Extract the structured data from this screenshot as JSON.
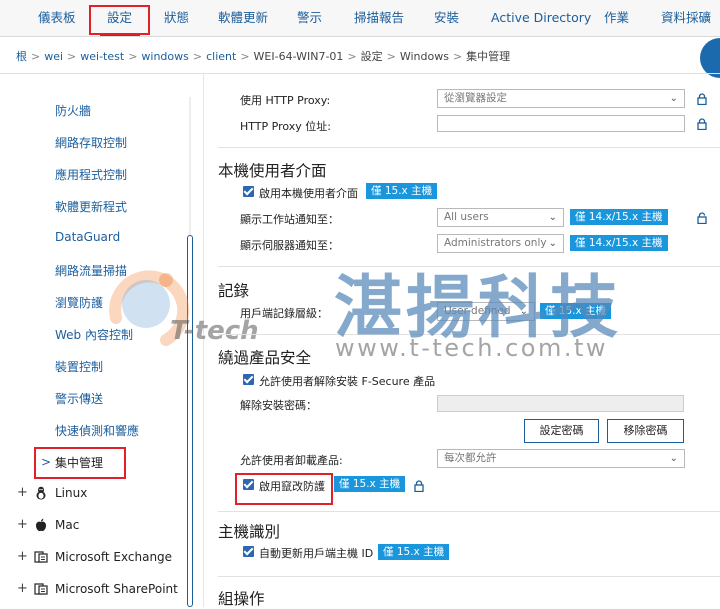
{
  "nav": {
    "tabs": [
      "儀表板",
      "設定",
      "狀態",
      "軟體更新",
      "警示",
      "掃描報告",
      "安裝",
      "Active Directory",
      "作業",
      "資料採礦"
    ],
    "active_index": 1
  },
  "breadcrumb": [
    "根",
    "wei",
    "wei-test",
    "windows",
    "client",
    "WEI-64-WIN7-01",
    "設定",
    "Windows",
    "集中管理"
  ],
  "sidebar": {
    "items": [
      "防火牆",
      "網路存取控制",
      "應用程式控制",
      "軟體更新程式",
      "DataGuard",
      "網路流量掃描",
      "瀏覽防護",
      "Web 內容控制",
      "裝置控制",
      "警示傳送",
      "快速偵測和響應"
    ],
    "selected": "集中管理",
    "os_groups": [
      {
        "label": "Linux",
        "icon": "linux-icon"
      },
      {
        "label": "Mac",
        "icon": "apple-icon"
      },
      {
        "label": "Microsoft Exchange",
        "icon": "server-icon"
      },
      {
        "label": "Microsoft SharePoint",
        "icon": "server-icon"
      }
    ]
  },
  "proxy": {
    "use_label": "使用 HTTP Proxy:",
    "use_value": "從瀏覽器設定",
    "address_label": "HTTP Proxy 位址:"
  },
  "local_ui": {
    "title": "本機使用者介面",
    "enable_label": "啟用本機使用者介面",
    "enable_badge": "僅 15.x 主機",
    "workstation_label": "顯示工作站通知至：",
    "workstation_value": "All users",
    "workstation_badge": "僅 14.x/15.x 主機",
    "server_label": "顯示伺服器通知至：",
    "server_value": "Administrators only",
    "server_badge": "僅 14.x/15.x 主機"
  },
  "logging": {
    "title": "記錄",
    "level_label": "用戶端記錄層級：",
    "level_value": "User-defined",
    "level_badge": "僅 15.x 主機"
  },
  "bypass": {
    "title": "繞過產品安全",
    "allow_uninstall_label": "允許使用者解除安裝 F-Secure 產品",
    "uninstall_password_label": "解除安裝密碼：",
    "set_password_button": "設定密碼",
    "remove_password_button": "移除密碼",
    "allow_unload_label": "允許使用者卸載產品:",
    "allow_unload_value": "每次都允許",
    "tamper_label": "啟用竄改防護",
    "tamper_badge": "僅 15.x 主機"
  },
  "host_id": {
    "title": "主機識別",
    "auto_update_label": "自動更新用戶端主機 ID",
    "auto_update_badge": "僅 15.x 主機"
  },
  "group_ops": {
    "title": "組操作"
  },
  "watermark": {
    "company": "湛揚科技",
    "url": "www.t-tech.com.tw",
    "logo_text": "T-tech"
  }
}
